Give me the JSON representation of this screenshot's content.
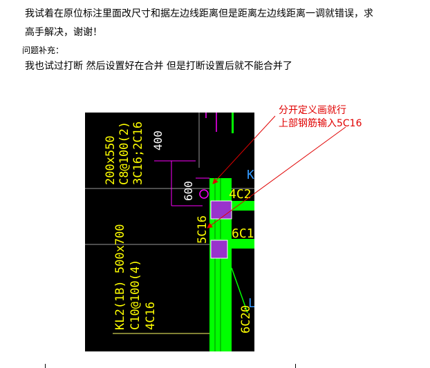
{
  "question": {
    "line1": "我试着在原位标注里面改尺寸和据左边线距离但是距离左边线距离一调就错误，求",
    "line2": "高手解决，谢谢！"
  },
  "supplement": {
    "label": "问题补充：",
    "text": "我也试过打断 然后设置好在合并 但是打断设置后就不能合并了"
  },
  "cad": {
    "beam1_size": "200x550",
    "beam1_stirrup": "C8@100(2)",
    "beam1_top": "3C16;2C16",
    "dim_400": "400",
    "dim_600": "600",
    "label_k": "K",
    "label_4c2": "4C2",
    "label_6c1": "6C1",
    "label_5c16": "5C16",
    "beam2_size": "KL2(1B) 500x700",
    "beam2_stirrup": "C10@100(4)",
    "beam2_top": "4C16",
    "label_6c20": "6C20",
    "label_l": "L",
    "colors": {
      "background": "#000000",
      "beam_green": "#00ff00",
      "dim_magenta": "#ff00ff",
      "support_purple": "#9933cc",
      "text_yellow": "#ffff00",
      "text_white": "#ffffff",
      "label_blue": "#3399ff",
      "gray_line": "#9a9a9a"
    }
  },
  "annotation": {
    "line1": "分开定义画就行",
    "line2": "上部钢筋输入5C16",
    "color": "#e00000"
  }
}
